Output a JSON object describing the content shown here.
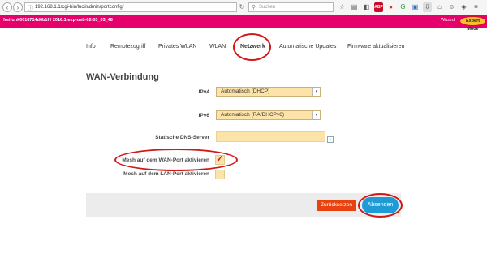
{
  "browser": {
    "url": "192.168.1.1/cgi-bin/luci/admin/portconfig/",
    "search_placeholder": "Suchen"
  },
  "header": {
    "hostname": "freifunk0018714d6b1f / 2016.1-exp-usb-02-03_03_48",
    "wizard_label": "Wizard",
    "expert_mode_label": "Expert Mode"
  },
  "nav": {
    "tabs": [
      "Info",
      "Remotezugriff",
      "Privates WLAN",
      "WLAN",
      "Netzwerk",
      "Automatische Updates",
      "Firmware aktualisieren"
    ],
    "active": "Netzwerk"
  },
  "form": {
    "section_title": "WAN-Verbindung",
    "ipv4_label": "IPv4",
    "ipv4_value": "Automatisch (DHCP)",
    "ipv6_label": "IPv6",
    "ipv6_value": "Automatisch (RA/DHCPv6)",
    "dns_label": "Statische DNS-Server",
    "dns_value": "",
    "mesh_wan_label": "Mesh auf dem WAN-Port aktivieren",
    "mesh_wan_checked": true,
    "mesh_lan_label": "Mesh auf dem LAN-Port aktivieren",
    "mesh_lan_checked": false
  },
  "actions": {
    "reset_label": "Zurücksetzen",
    "submit_label": "Absenden"
  },
  "colors": {
    "brand": "#e5006b",
    "field_bg": "#fce4a8",
    "reset": "#e8420f",
    "submit": "#1e9bd7",
    "highlight": "#d01818"
  }
}
